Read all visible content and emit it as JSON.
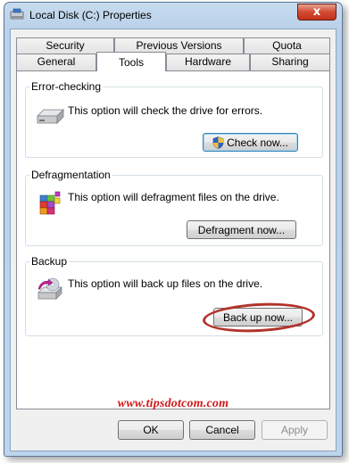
{
  "window": {
    "title": "Local Disk (C:) Properties",
    "close_label": "x"
  },
  "tabs": {
    "row1": [
      "Security",
      "Previous Versions",
      "Quota"
    ],
    "row2": [
      "General",
      "Tools",
      "Hardware",
      "Sharing"
    ],
    "active": "Tools"
  },
  "error_checking": {
    "title": "Error-checking",
    "description": "This option will check the drive for errors.",
    "button_label": "Check now...",
    "icon": "drive-icon"
  },
  "defragmentation": {
    "title": "Defragmentation",
    "description": "This option will defragment files on the drive.",
    "button_label": "Defragment now...",
    "icon": "defragment-icon"
  },
  "backup": {
    "title": "Backup",
    "description": "This option will back up files on the drive.",
    "button_label": "Back up now...",
    "icon": "backup-icon"
  },
  "watermark": "www.tipsdotcom.com",
  "footer": {
    "ok_label": "OK",
    "cancel_label": "Cancel",
    "apply_label": "Apply"
  },
  "colors": {
    "highlight_oval": "#b2332a",
    "watermark": "#d11616",
    "close_button": "#c2321c"
  }
}
